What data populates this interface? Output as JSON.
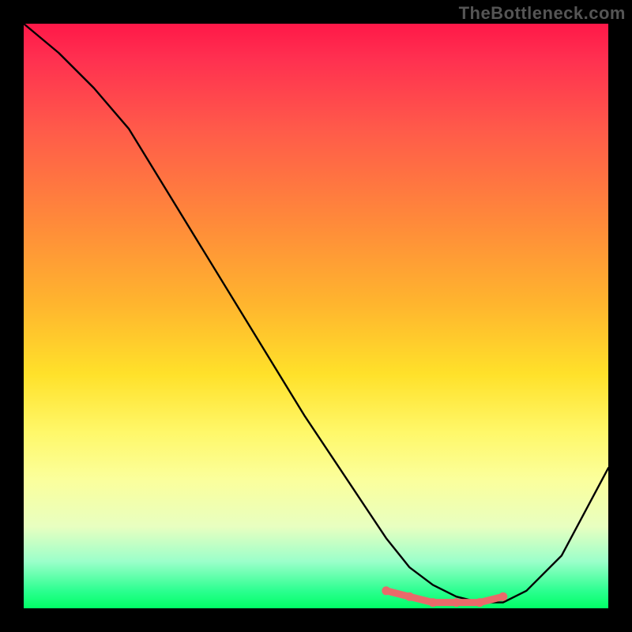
{
  "watermark": "TheBottleneck.com",
  "chart_data": {
    "type": "line",
    "title": "",
    "xlabel": "",
    "ylabel": "",
    "xlim": [
      0,
      100
    ],
    "ylim": [
      0,
      100
    ],
    "series": [
      {
        "name": "bottleneck-curve",
        "x": [
          0,
          6,
          12,
          18,
          48,
          56,
          62,
          66,
          70,
          74,
          78,
          82,
          86,
          92,
          100
        ],
        "values": [
          100,
          95,
          89,
          82,
          33,
          21,
          12,
          7,
          4,
          2,
          1,
          1,
          3,
          9,
          24
        ]
      }
    ],
    "highlight_region": {
      "name": "optimal-range",
      "x": [
        62,
        66,
        70,
        74,
        78,
        82
      ],
      "values": [
        3,
        2,
        1,
        1,
        1,
        2
      ]
    },
    "colors": {
      "curve": "#000000",
      "highlight": "#e96a6a",
      "background_top": "#ff1848",
      "background_bottom": "#00ff66",
      "frame": "#000000"
    }
  }
}
